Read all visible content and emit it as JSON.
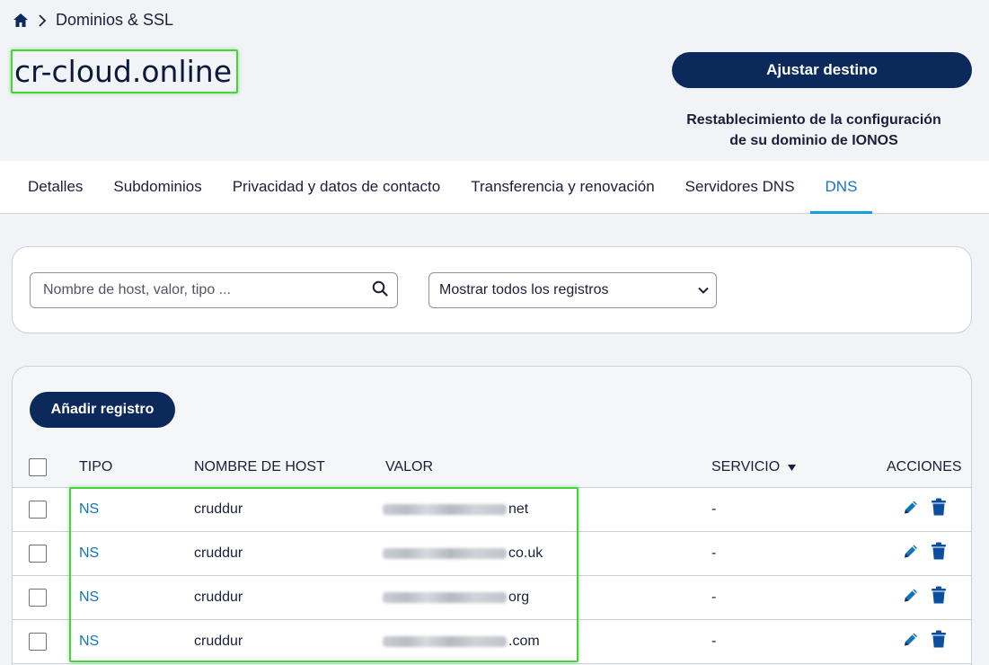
{
  "breadcrumb": {
    "home_icon": "home-icon",
    "separator_icon": "chevron-right-icon",
    "current": "Dominios & SSL"
  },
  "domain": {
    "name": "cr-cloud.online"
  },
  "header": {
    "adjust_button": "Ajustar destino",
    "reset_line1": "Restablecimiento de la configuración",
    "reset_line2": "de su dominio de IONOS"
  },
  "tabs": [
    {
      "label": "Detalles",
      "active": false
    },
    {
      "label": "Subdominios",
      "active": false
    },
    {
      "label": "Privacidad y datos de contacto",
      "active": false
    },
    {
      "label": "Transferencia y renovación",
      "active": false
    },
    {
      "label": "Servidores DNS",
      "active": false
    },
    {
      "label": "DNS",
      "active": true
    }
  ],
  "filters": {
    "search_placeholder": "Nombre de host, valor, tipo ...",
    "search_icon": "search-icon",
    "select_value": "Mostrar todos los registros",
    "select_icon": "chevron-down-icon"
  },
  "records": {
    "add_button": "Añadir registro",
    "columns": {
      "type": "TIPO",
      "host": "NOMBRE DE HOST",
      "value": "VALOR",
      "service": "SERVICIO",
      "actions": "ACCIONES"
    },
    "sort_icon": "sort-down-icon",
    "rows": [
      {
        "type": "NS",
        "host": "cruddur",
        "value_suffix": "net",
        "service": "-"
      },
      {
        "type": "NS",
        "host": "cruddur",
        "value_suffix": "co.uk",
        "service": "-"
      },
      {
        "type": "NS",
        "host": "cruddur",
        "value_suffix": "org",
        "service": "-"
      },
      {
        "type": "NS",
        "host": "cruddur",
        "value_suffix": ".com",
        "service": "-"
      }
    ]
  },
  "colors": {
    "primary": "#0b2a5b",
    "link": "#1474b8",
    "highlight": "#46d43e",
    "tab_underline": "#14a0d8"
  }
}
